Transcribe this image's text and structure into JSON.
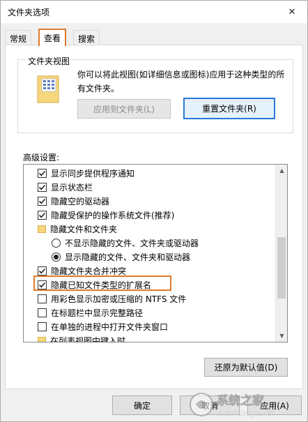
{
  "window": {
    "title": "文件夹选项",
    "close_glyph": "✕"
  },
  "tabs": [
    {
      "label": "常规"
    },
    {
      "label": "查看"
    },
    {
      "label": "搜索"
    }
  ],
  "folder_views": {
    "title": "文件夹视图",
    "description": "你可以将此视图(如详细信息或图标)应用于这种类型的所有文件夹。",
    "apply_button": "应用到文件夹(L)",
    "reset_button": "重置文件夹(R)"
  },
  "advanced": {
    "label": "高级设置:",
    "items": [
      {
        "type": "checkbox",
        "checked": true,
        "label": "显示同步提供程序通知"
      },
      {
        "type": "checkbox",
        "checked": true,
        "label": "显示状态栏"
      },
      {
        "type": "checkbox",
        "checked": true,
        "label": "隐藏空的驱动器"
      },
      {
        "type": "checkbox",
        "checked": true,
        "label": "隐藏受保护的操作系统文件(推荐)"
      },
      {
        "type": "folder",
        "label": "隐藏文件和文件夹"
      },
      {
        "type": "radio",
        "checked": false,
        "label": "不显示隐藏的文件、文件夹或驱动器"
      },
      {
        "type": "radio",
        "checked": true,
        "label": "显示隐藏的文件、文件夹和驱动器"
      },
      {
        "type": "checkbox",
        "checked": true,
        "label": "隐藏文件夹合并冲突"
      },
      {
        "type": "checkbox",
        "checked": true,
        "label": "隐藏已知文件类型的扩展名"
      },
      {
        "type": "checkbox",
        "checked": false,
        "label": "用彩色显示加密或压缩的 NTFS 文件"
      },
      {
        "type": "checkbox",
        "checked": false,
        "label": "在标题栏中显示完整路径"
      },
      {
        "type": "checkbox",
        "checked": false,
        "label": "在单独的进程中打开文件夹窗口"
      },
      {
        "type": "folder",
        "label": "在列表视图中键入时"
      }
    ],
    "restore_button": "还原为默认值(D)"
  },
  "footer": {
    "ok_button": "确定",
    "cancel_button": "取消",
    "apply_button": "应用(A)"
  },
  "watermark": {
    "brand": "系统之家",
    "url": "XITONGZHIJIA.NET"
  },
  "colors": {
    "highlight": "#e07a2a",
    "focus": "#2a78d6"
  }
}
